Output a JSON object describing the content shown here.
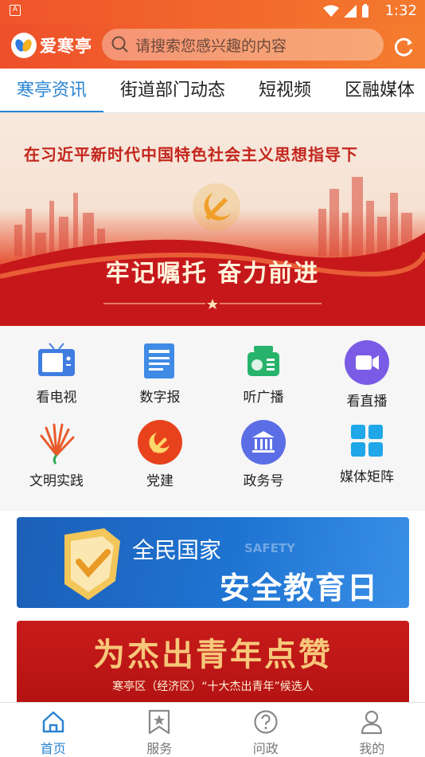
{
  "status_bar": {
    "time": "1:32"
  },
  "header": {
    "app_name": "爱寒亭",
    "search_placeholder": "请搜索您感兴趣的内容"
  },
  "tabs": [
    {
      "label": "寒亭资讯",
      "active": true
    },
    {
      "label": "街道部门动态",
      "active": false
    },
    {
      "label": "短视频",
      "active": false
    },
    {
      "label": "区融媒体",
      "active": false
    }
  ],
  "banner": {
    "headline": "在习近平新时代中国特色社会主义思想指导下",
    "slogan": "牢记嘱托 奋力前进"
  },
  "grid": [
    {
      "label": "看电视",
      "icon": "tv-icon",
      "color": "#3f7de0"
    },
    {
      "label": "数字报",
      "icon": "newspaper-icon",
      "color": "#3f8be6"
    },
    {
      "label": "听广播",
      "icon": "radio-icon",
      "color": "#27b36b"
    },
    {
      "label": "看直播",
      "icon": "live-video-icon",
      "color": "#7a5be6"
    },
    {
      "label": "文明实践",
      "icon": "civilization-icon",
      "color": "#e85a2a"
    },
    {
      "label": "党建",
      "icon": "party-building-icon",
      "color": "#e8421d"
    },
    {
      "label": "政务号",
      "icon": "government-icon",
      "color": "#5b6ee6"
    },
    {
      "label": "媒体矩阵",
      "icon": "media-matrix-icon",
      "color": "#1fa7e8"
    }
  ],
  "cards": {
    "safety": {
      "line1": "全民国家",
      "line1_sub": "SAFETY",
      "line2": "安全教育日"
    },
    "youth": {
      "title": "为杰出青年点赞",
      "subtitle": "寒亭区（经济区）“十大杰出青年”候选人"
    }
  },
  "bottom_nav": [
    {
      "label": "首页",
      "icon": "home-icon",
      "active": true
    },
    {
      "label": "服务",
      "icon": "service-icon",
      "active": false
    },
    {
      "label": "问政",
      "icon": "question-icon",
      "active": false
    },
    {
      "label": "我的",
      "icon": "profile-icon",
      "active": false
    }
  ],
  "colors": {
    "header": "#f26a2c",
    "accent": "#2a84d2"
  }
}
